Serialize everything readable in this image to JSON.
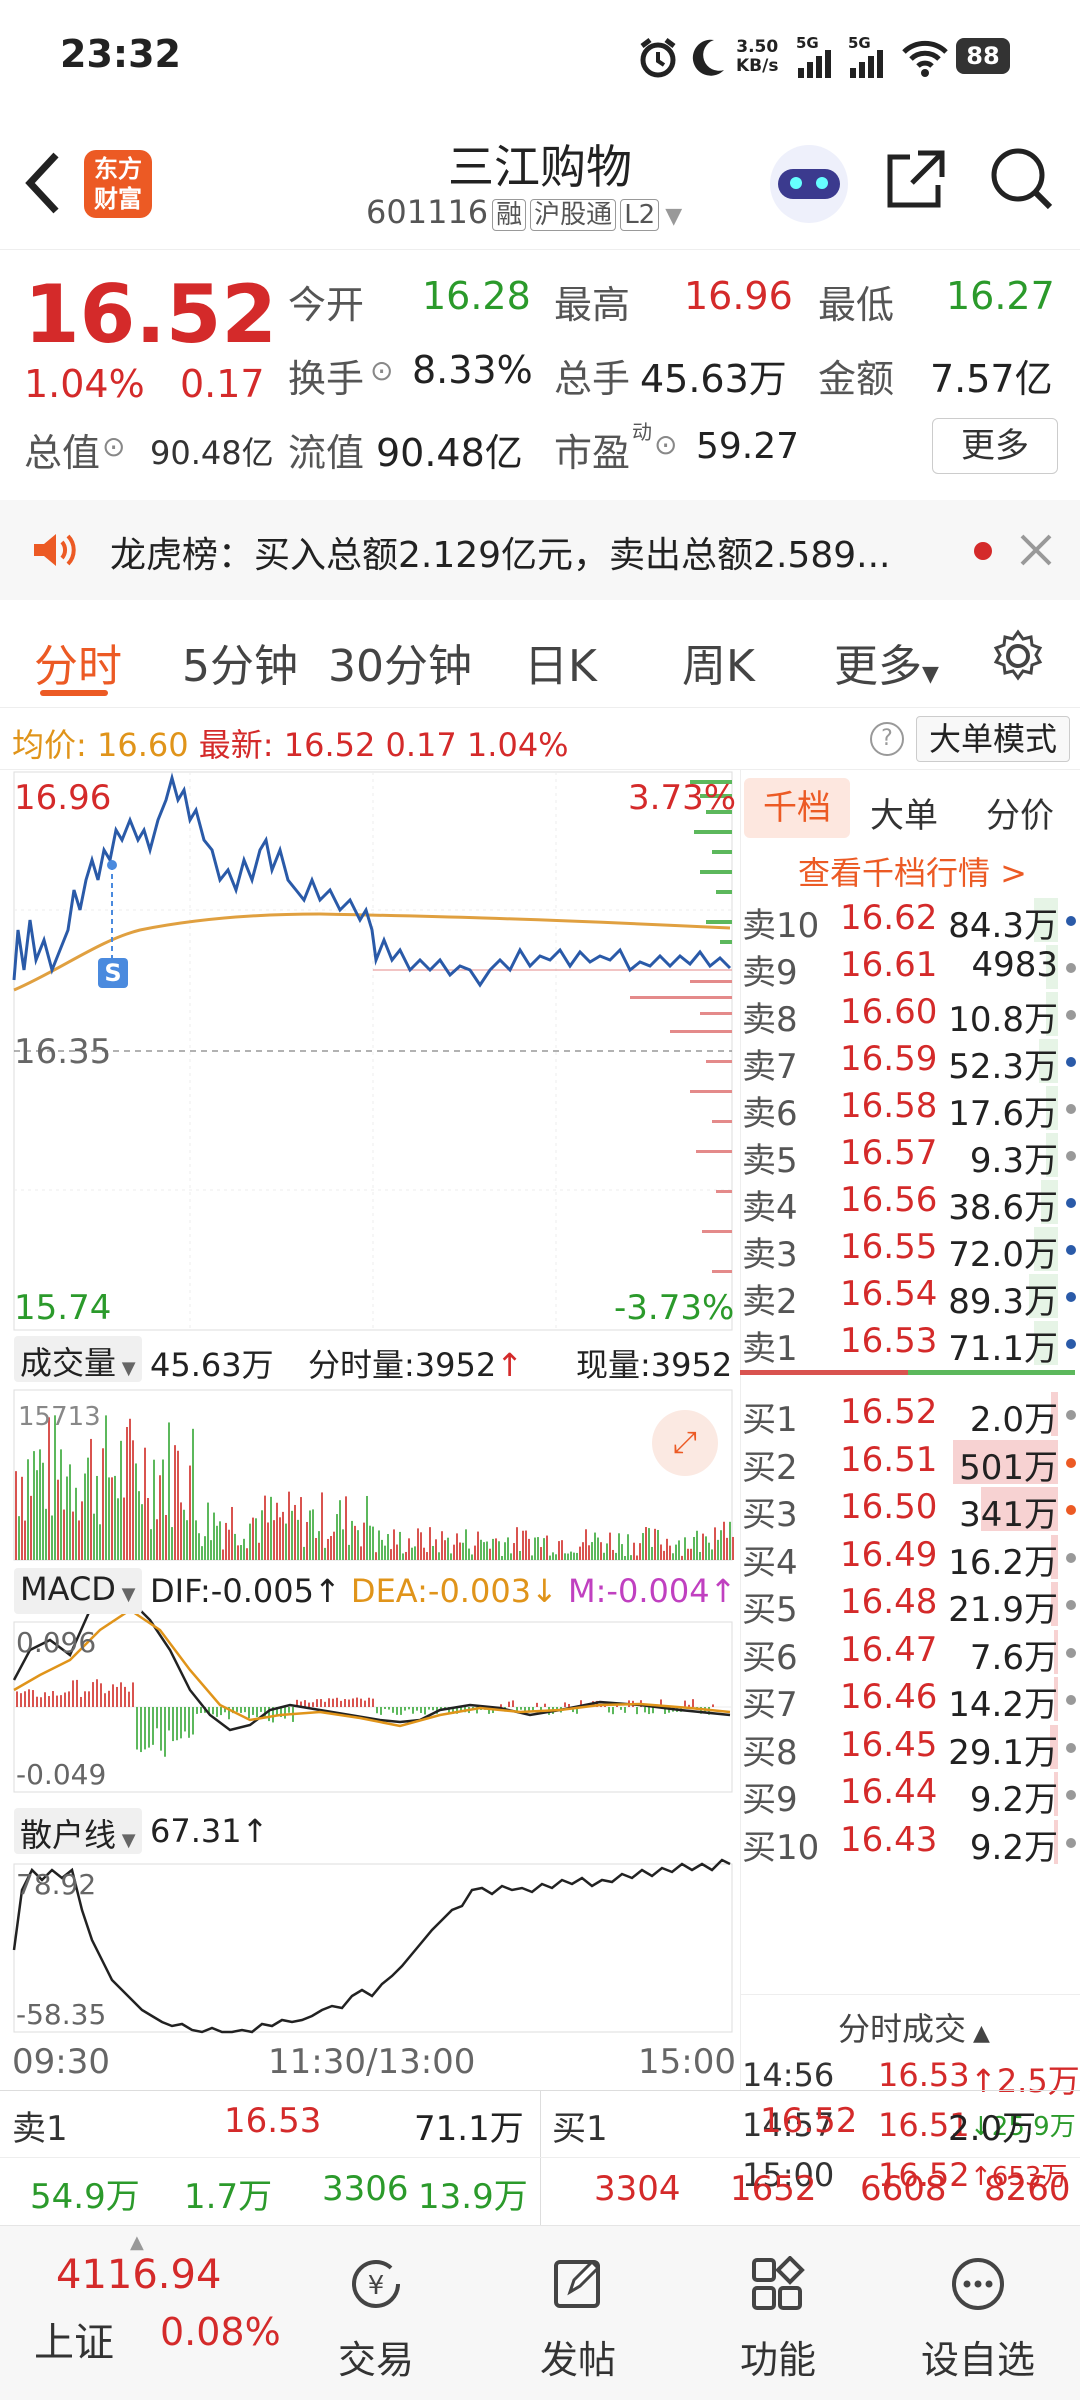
{
  "status_bar": {
    "time": "23:32",
    "net_speed_top": "3.50",
    "net_speed_bottom": "KB/s",
    "signal1": "5G",
    "signal2": "5G",
    "battery": "88"
  },
  "header": {
    "logo_top": "东方",
    "logo_bottom": "财富",
    "title": "三江购物",
    "code": "601116",
    "tag_rong": "融",
    "tag_hgt": "沪股通",
    "tag_l2": "L2"
  },
  "quote": {
    "price": "16.52",
    "change_pct": "1.04%",
    "change": "0.17",
    "open_label": "今开",
    "open": "16.28",
    "high_label": "最高",
    "high": "16.96",
    "low_label": "最低",
    "low": "16.27",
    "turnover_label": "换手",
    "turnover": "8.33%",
    "volume_label": "总手",
    "volume": "45.63万",
    "amount_label": "金额",
    "amount": "7.57亿",
    "mktcap_label": "总值",
    "mktcap": "90.48亿",
    "float_label": "流值",
    "float_cap": "90.48亿",
    "pe_label": "市盈",
    "pe_sup": "动",
    "pe": "59.27",
    "more_label": "更多"
  },
  "notice": {
    "text": "龙虎榜：买入总额2.129亿元，卖出总额2.589..."
  },
  "tabs": {
    "t1": "分时",
    "t2": "5分钟",
    "t3": "30分钟",
    "t4": "日K",
    "t5": "周K",
    "t6": "更多"
  },
  "avgbar": {
    "avg_label": "均价:",
    "avg": "16.60",
    "latest_label": "最新:",
    "latest": "16.52",
    "chg": "0.17",
    "pct": "1.04%",
    "mode": "大单模式"
  },
  "chart_labels": {
    "price_high": "16.96",
    "pct_high": "3.73%",
    "price_mid": "16.35",
    "price_low": "15.74",
    "pct_low": "-3.73%",
    "s_marker": "S",
    "vol_label": "成交量",
    "vol_total": "45.63万",
    "vol_tick_label": "分时量:3952",
    "vol_now": "现量:3952",
    "vol_max": "15713",
    "macd_label": "MACD",
    "dif": "DIF:-0.005",
    "dea": "DEA:-0.003",
    "m": "M:-0.004",
    "macd_max": "0.096",
    "macd_min": "-0.049",
    "retail_label": "散户线",
    "retail_val": "67.31",
    "retail_max": "78.92",
    "retail_min": "-58.35",
    "time_start": "09:30",
    "time_mid": "11:30/13:00",
    "time_end": "15:00"
  },
  "orderbook": {
    "tab1": "千档",
    "tab2": "大单",
    "tab3": "分价",
    "view_all": "查看千档行情 >",
    "sells": [
      {
        "label": "卖10",
        "price": "16.62",
        "vol": "84.3万"
      },
      {
        "label": "卖9",
        "price": "16.61",
        "vol": "4983"
      },
      {
        "label": "卖8",
        "price": "16.60",
        "vol": "10.8万"
      },
      {
        "label": "卖7",
        "price": "16.59",
        "vol": "52.3万"
      },
      {
        "label": "卖6",
        "price": "16.58",
        "vol": "17.6万"
      },
      {
        "label": "卖5",
        "price": "16.57",
        "vol": "9.3万"
      },
      {
        "label": "卖4",
        "price": "16.56",
        "vol": "38.6万"
      },
      {
        "label": "卖3",
        "price": "16.55",
        "vol": "72.0万"
      },
      {
        "label": "卖2",
        "price": "16.54",
        "vol": "89.3万"
      },
      {
        "label": "卖1",
        "price": "16.53",
        "vol": "71.1万"
      }
    ],
    "buys": [
      {
        "label": "买1",
        "price": "16.52",
        "vol": "2.0万"
      },
      {
        "label": "买2",
        "price": "16.51",
        "vol": "501万"
      },
      {
        "label": "买3",
        "price": "16.50",
        "vol": "341万"
      },
      {
        "label": "买4",
        "price": "16.49",
        "vol": "16.2万"
      },
      {
        "label": "买5",
        "price": "16.48",
        "vol": "21.9万"
      },
      {
        "label": "买6",
        "price": "16.47",
        "vol": "7.6万"
      },
      {
        "label": "买7",
        "price": "16.46",
        "vol": "14.2万"
      },
      {
        "label": "买8",
        "price": "16.45",
        "vol": "29.1万"
      },
      {
        "label": "买9",
        "price": "16.44",
        "vol": "9.2万"
      },
      {
        "label": "买10",
        "price": "16.43",
        "vol": "9.2万"
      }
    ],
    "ticks_title": "分时成交",
    "ticks": [
      {
        "time": "14:56",
        "price": "16.53",
        "vol": "2.5万"
      },
      {
        "time": "14:57",
        "price": "16.51",
        "vol": "25.9万"
      },
      {
        "time": "15:00",
        "price": "16.52",
        "vol": "653万"
      }
    ]
  },
  "bottom_quote": {
    "s1_label": "卖1",
    "s1_price": "16.53",
    "s1_vol": "71.1万",
    "b1_label": "买1",
    "b1_price": "16.52",
    "b1_vol": "2.0万",
    "g1": "54.9万",
    "g2": "1.7万",
    "g3": "3306",
    "g4": "13.9万",
    "r1": "3304",
    "r2": "1652",
    "r3": "6608",
    "r4": "8260"
  },
  "bottom_nav": {
    "index_value": "4116.94",
    "index_name": "上证",
    "index_pct": "0.08%",
    "trade": "交易",
    "post": "发帖",
    "func": "功能",
    "watch": "设自选"
  }
}
